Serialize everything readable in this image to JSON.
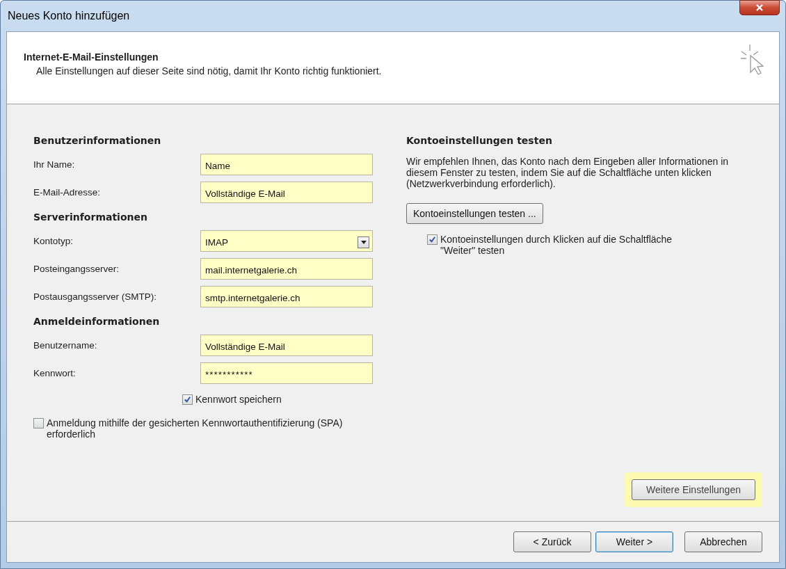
{
  "window": {
    "title": "Neues Konto hinzufügen"
  },
  "header": {
    "title": "Internet-E-Mail-Einstellungen",
    "subtitle": "Alle Einstellungen auf dieser Seite sind nötig, damit Ihr Konto richtig funktioniert."
  },
  "left_sections": [
    {
      "heading": "Benutzerinformationen",
      "fields": [
        {
          "label": "Ihr Name:",
          "kind": "text",
          "value": "Name"
        },
        {
          "label": "E-Mail-Adresse:",
          "kind": "text",
          "value": "Vollständige E-Mail"
        }
      ]
    },
    {
      "heading": "Serverinformationen",
      "fields": [
        {
          "label": "Kontotyp:",
          "kind": "dropdown",
          "value": "IMAP"
        },
        {
          "label": "Posteingangsserver:",
          "kind": "text",
          "value": "mail.internetgalerie.ch"
        },
        {
          "label": "Postausgangsserver (SMTP):",
          "kind": "text",
          "value": "smtp.internetgalerie.ch"
        }
      ]
    },
    {
      "heading": "Anmeldeinformationen",
      "fields": [
        {
          "label": "Benutzername:",
          "kind": "text",
          "value": "Vollständige E-Mail"
        },
        {
          "label": "Kennwort:",
          "kind": "password",
          "value": "***********"
        }
      ]
    }
  ],
  "save_password": {
    "label": "Kennwort speichern",
    "checked": true
  },
  "spa": {
    "label": "Anmeldung mithilfe der gesicherten Kennwortauthentifizierung (SPA) erforderlich",
    "checked": false
  },
  "test_panel": {
    "heading": "Kontoeinstellungen testen",
    "description": "Wir empfehlen Ihnen, das Konto nach dem Eingeben aller Informationen in diesem Fenster zu testen, indem Sie auf die Schaltfläche unten klicken (Netzwerkverbindung erforderlich).",
    "button": "Kontoeinstellungen testen ...",
    "auto_test": {
      "label": "Kontoeinstellungen durch Klicken auf die Schaltfläche \"Weiter\" testen",
      "checked": true
    }
  },
  "more_settings": {
    "label": "Weitere Einstellungen",
    "highlighted": true
  },
  "footer_buttons": [
    {
      "label": "< Zurück",
      "selected": false
    },
    {
      "label": "Weiter >",
      "selected": true
    },
    {
      "label": "Abbrechen",
      "selected": false
    }
  ]
}
